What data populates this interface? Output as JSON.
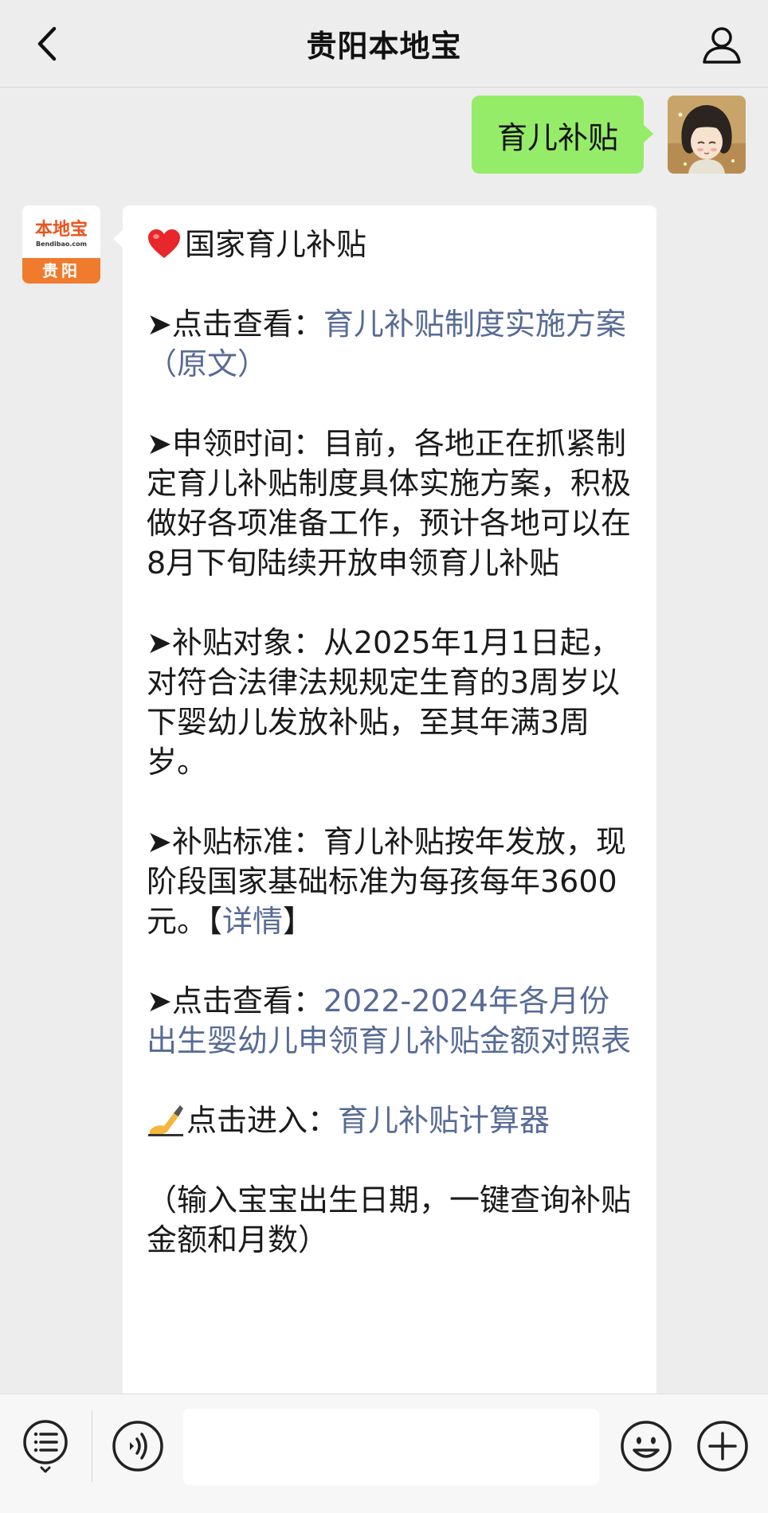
{
  "header": {
    "title": "贵阳本地宝",
    "back_icon": "chevron-left-icon",
    "profile_icon": "user-icon"
  },
  "outgoing_message": {
    "text": "育儿补贴",
    "bubble_color": "#95ec69"
  },
  "bot_avatar": {
    "logo_main": "本地宝",
    "logo_sub": "Bendibao.com",
    "logo_city": "贵阳",
    "accent": "#f07b2d"
  },
  "incoming_message": {
    "heading": "国家育儿补贴",
    "link_color": "#576b95",
    "item1": {
      "prefix": "➤点击查看：",
      "link": "育儿补贴制度实施方案（原文）"
    },
    "item2": {
      "text": "➤申领时间：目前，各地正在抓紧制定育儿补贴制度具体实施方案，积极做好各项准备工作，预计各地可以在8月下旬陆续开放申领育儿补贴"
    },
    "item3": {
      "text": "➤补贴对象：从2025年1月1日起，对符合法律法规规定生育的3周岁以下婴幼儿发放补贴，至其年满3周岁。"
    },
    "item4": {
      "text": "➤补贴标准：育儿补贴按年发放，现阶段国家基础标准为每孩每年3600元。【",
      "link": "详情",
      "suffix": "】"
    },
    "item5": {
      "prefix": "➤点击查看：",
      "link": "2022-2024年各月份出生婴幼儿申领育儿补贴金额对照表"
    },
    "item6": {
      "prefix": "点击进入：",
      "link": "育儿补贴计算器"
    },
    "item7": {
      "text": "（输入宝宝出生日期，一键查询补贴金额和月数）"
    }
  },
  "toolbar": {
    "menu_icon": "menu-list-icon",
    "voice_icon": "voice-icon",
    "emoji_icon": "emoji-icon",
    "plus_icon": "plus-icon",
    "input_value": ""
  }
}
